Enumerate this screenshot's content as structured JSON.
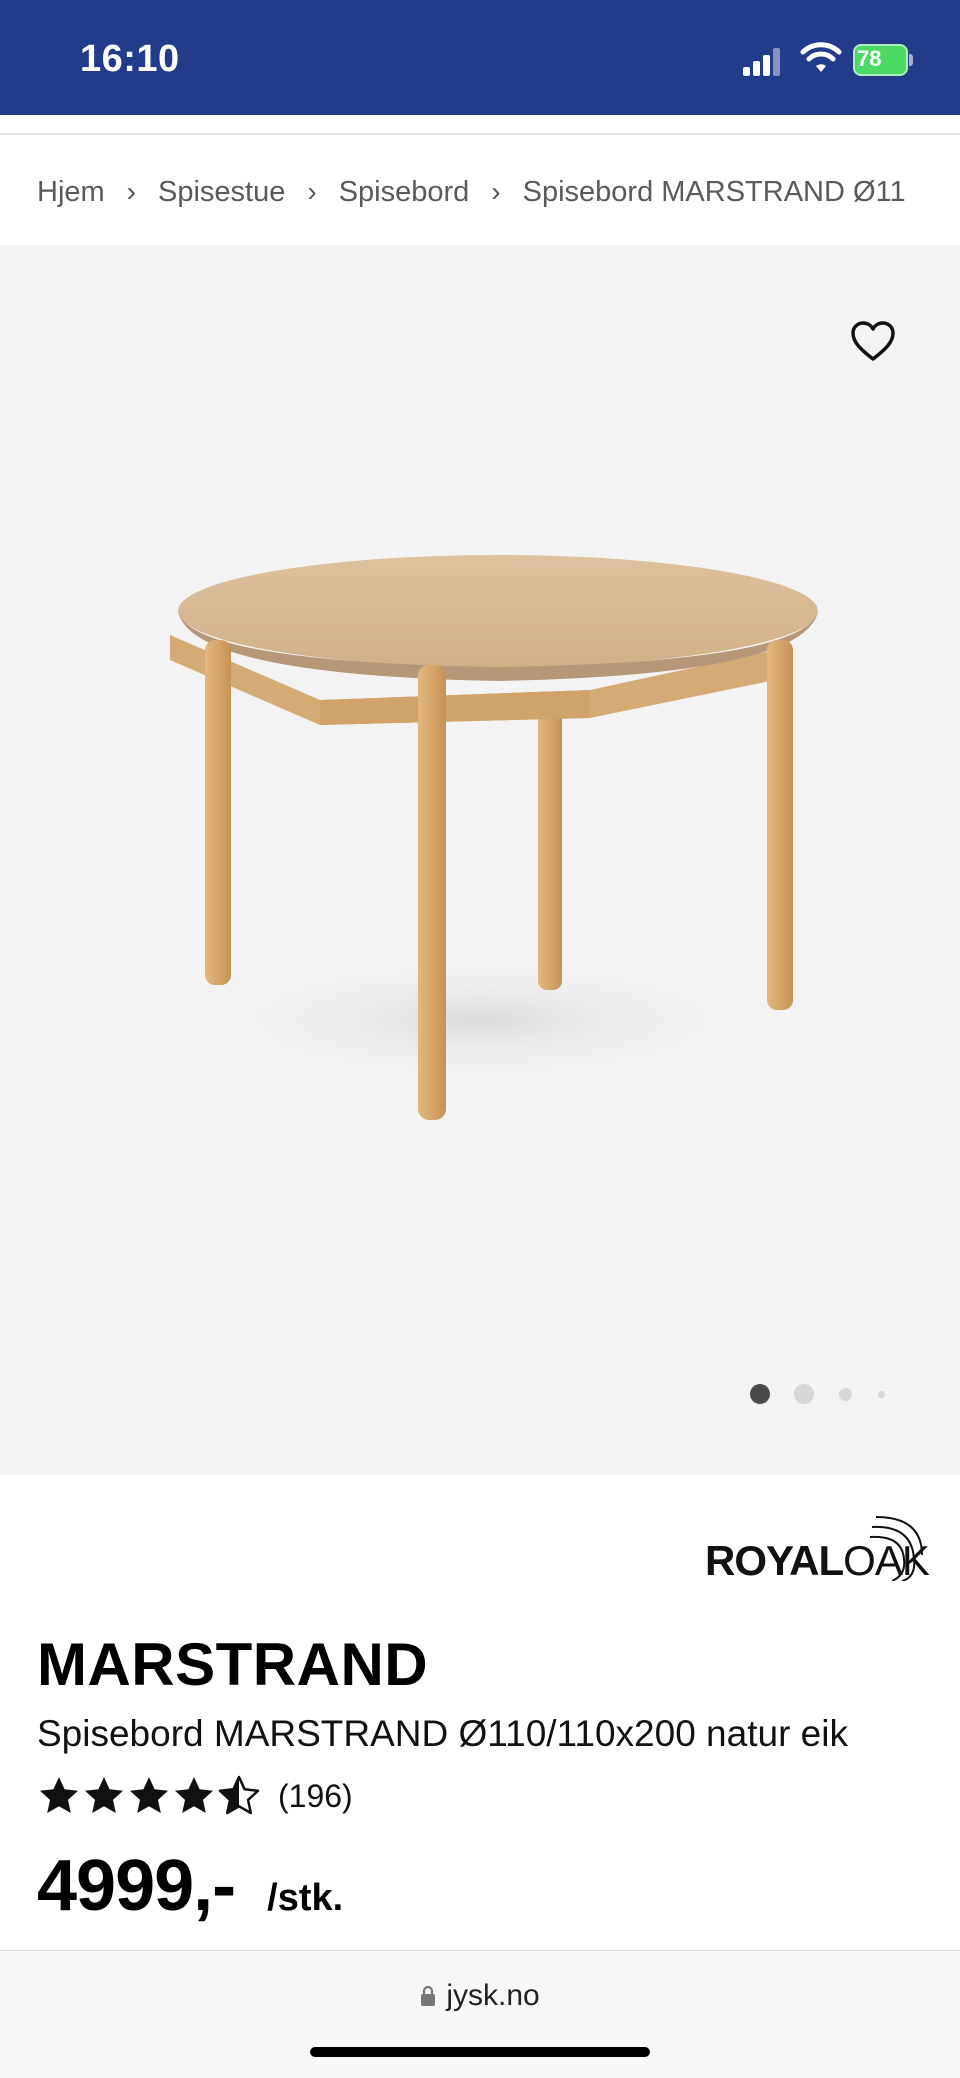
{
  "status_bar": {
    "time": "16:10",
    "battery": "78",
    "background_color": "#233b8b",
    "battery_color": "#4cd964"
  },
  "breadcrumb": {
    "items": [
      "Hjem",
      "Spisestue",
      "Spisebord",
      "Spisebord MARSTRAND Ø11"
    ]
  },
  "gallery": {
    "favorite_icon": "heart-outline-icon",
    "image": "round-oak-dining-table",
    "carousel_count": 4,
    "active_index": 0,
    "background_color": "#f4f3f4"
  },
  "brand": {
    "name_bold": "ROYAL",
    "name_light": "OAK"
  },
  "product": {
    "name": "MARSTRAND",
    "description": "Spisebord MARSTRAND Ø110/110x200 natur eik",
    "rating": 4.5,
    "rating_max": 5,
    "review_count": "(196)",
    "price": "4999,-",
    "price_unit": "/stk."
  },
  "browser": {
    "url": "jysk.no"
  }
}
